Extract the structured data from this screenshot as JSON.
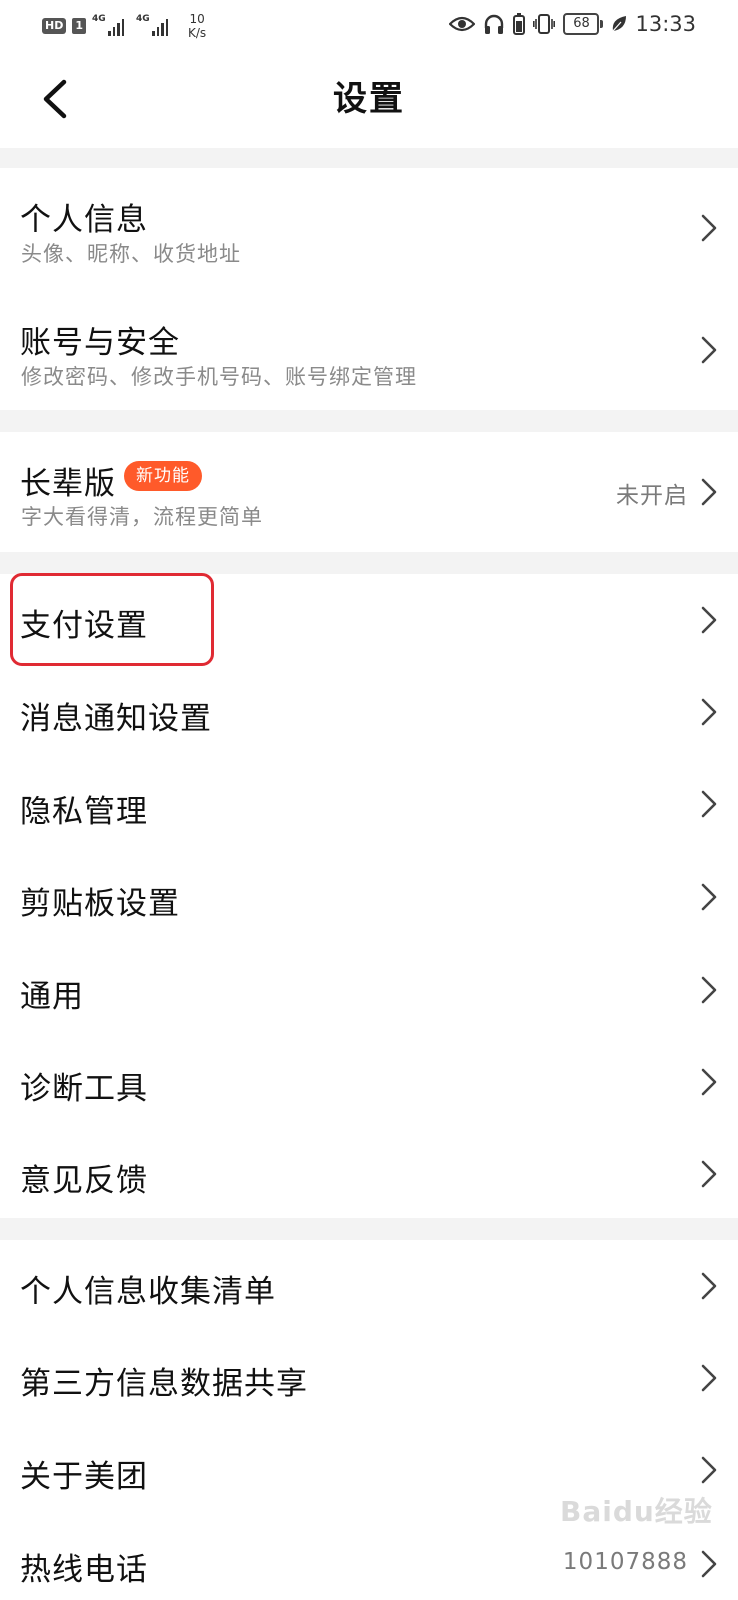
{
  "status_bar": {
    "hd": "HD",
    "sim": "1",
    "sig1": "4G",
    "sig2": "4G",
    "speed_value": "10",
    "speed_unit": "K/s",
    "battery": "68",
    "time": "13:33"
  },
  "header": {
    "title": "设置"
  },
  "items": [
    {
      "label": "个人信息",
      "sub": "头像、昵称、收货地址"
    },
    {
      "label": "账号与安全",
      "sub": "修改密码、修改手机号码、账号绑定管理"
    },
    {
      "label": "长辈版",
      "badge": "新功能",
      "sub": "字大看得清，流程更简单",
      "value": "未开启"
    },
    {
      "label": "支付设置"
    },
    {
      "label": "消息通知设置"
    },
    {
      "label": "隐私管理"
    },
    {
      "label": "剪贴板设置"
    },
    {
      "label": "通用"
    },
    {
      "label": "诊断工具"
    },
    {
      "label": "意见反馈"
    },
    {
      "label": "个人信息收集清单"
    },
    {
      "label": "第三方信息数据共享"
    },
    {
      "label": "关于美团"
    },
    {
      "label": "热线电话",
      "value": "10107888"
    }
  ],
  "watermark": "Baidu经验"
}
